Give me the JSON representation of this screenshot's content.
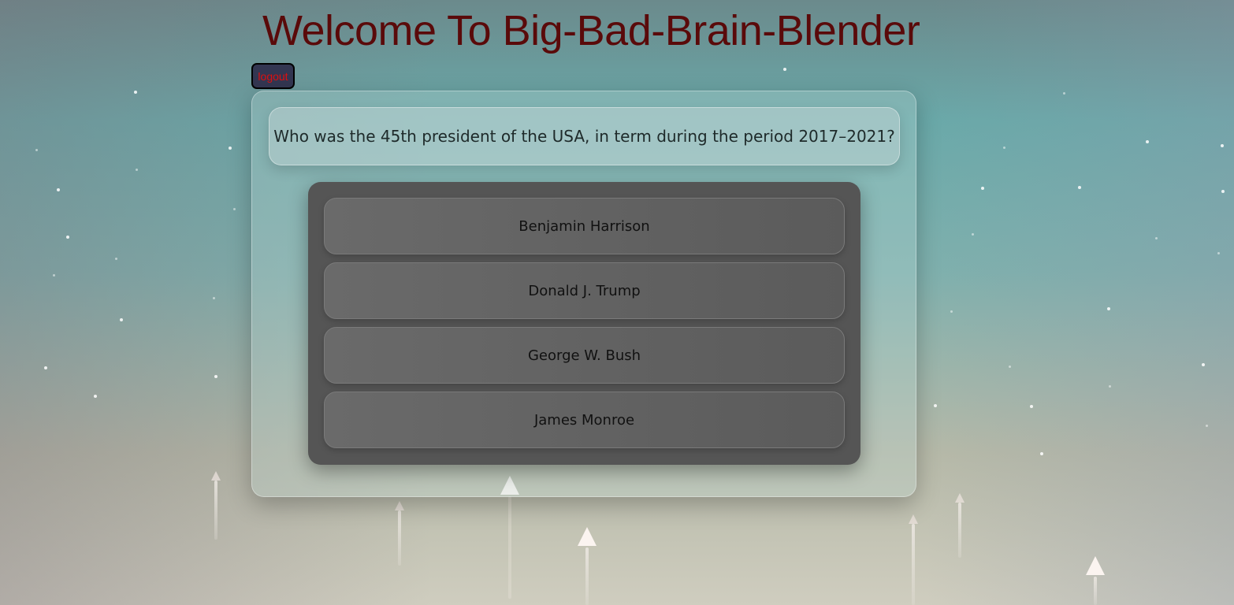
{
  "header": {
    "title": "Welcome To Big-Bad-Brain-Blender",
    "logout_label": "logout"
  },
  "quiz": {
    "question": "Who was the 45th president of the USA, in term during the period 2017–2021?",
    "answers": [
      "Benjamin Harrison",
      "Donald J. Trump",
      "George W. Bush",
      "James Monroe"
    ]
  }
}
